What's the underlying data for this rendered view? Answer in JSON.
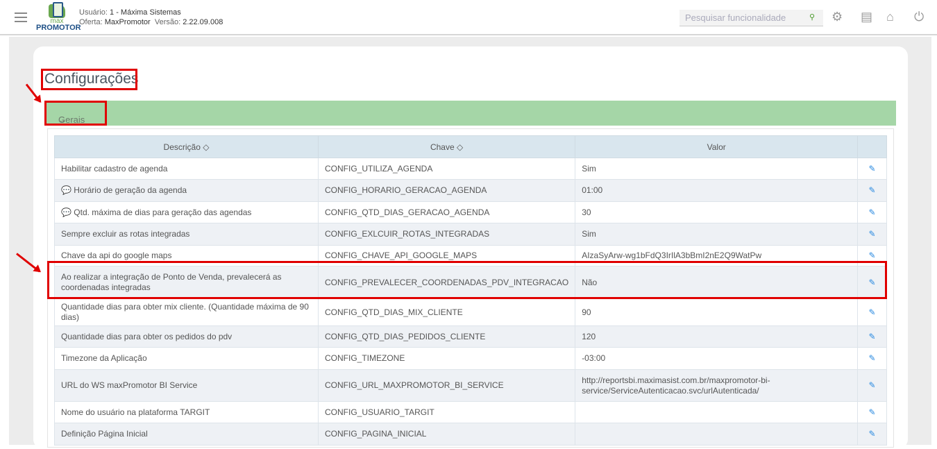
{
  "header": {
    "user_label": "Usuário:",
    "user_value": "1 - Máxima Sistemas",
    "offer_label": "Oferta:",
    "offer_value": "MaxPromotor",
    "version_label": "Versão:",
    "version_value": "2.22.09.008",
    "logo_text": "max PROMOTOR",
    "search_placeholder": "Pesquisar funcionalidade"
  },
  "page": {
    "title": "Configurações",
    "section": "Gerais"
  },
  "table": {
    "headers": [
      "Descrição ◇",
      "Chave ◇",
      "Valor",
      ""
    ],
    "rows": [
      [
        "Habilitar cadastro de agenda",
        "CONFIG_UTILIZA_AGENDA",
        "Sim"
      ],
      [
        "💬 Horário de geração da agenda",
        "CONFIG_HORARIO_GERACAO_AGENDA",
        "01:00"
      ],
      [
        "💬 Qtd. máxima de dias para geração das agendas",
        "CONFIG_QTD_DIAS_GERACAO_AGENDA",
        "30"
      ],
      [
        "Sempre excluir as rotas integradas",
        "CONFIG_EXLCUIR_ROTAS_INTEGRADAS",
        "Sim"
      ],
      [
        "Chave da api do google maps",
        "CONFIG_CHAVE_API_GOOGLE_MAPS",
        "AIzaSyArw-wg1bFdQ3IrIlA3bBmI2nE2Q9WatPw"
      ],
      [
        "Ao realizar a integração de Ponto de Venda, prevalecerá as coordenadas integradas",
        "CONFIG_PREVALECER_COORDENADAS_PDV_INTEGRACAO",
        "Não"
      ],
      [
        "Quantidade dias para obter mix cliente. (Quantidade máxima de 90 dias)",
        "CONFIG_QTD_DIAS_MIX_CLIENTE",
        "90"
      ],
      [
        "Quantidade dias para obter os pedidos do pdv",
        "CONFIG_QTD_DIAS_PEDIDOS_CLIENTE",
        "120"
      ],
      [
        "Timezone da Aplicação",
        "CONFIG_TIMEZONE",
        "-03:00"
      ],
      [
        "URL do WS maxPromotor BI Service",
        "CONFIG_URL_MAXPROMOTOR_BI_SERVICE",
        "http://reportsbi.maximasist.com.br/maxpromotor-bi-service/ServiceAutenticacao.svc/urlAutenticada/"
      ],
      [
        "Nome do usuário na plataforma TARGIT",
        "CONFIG_USUARIO_TARGIT",
        ""
      ],
      [
        "Definição Página Inicial",
        "CONFIG_PAGINA_INICIAL",
        ""
      ]
    ]
  },
  "colors": {
    "accent_green": "#a5d6a7",
    "highlight_red": "#e00000",
    "edit_blue": "#2a8ae0"
  }
}
